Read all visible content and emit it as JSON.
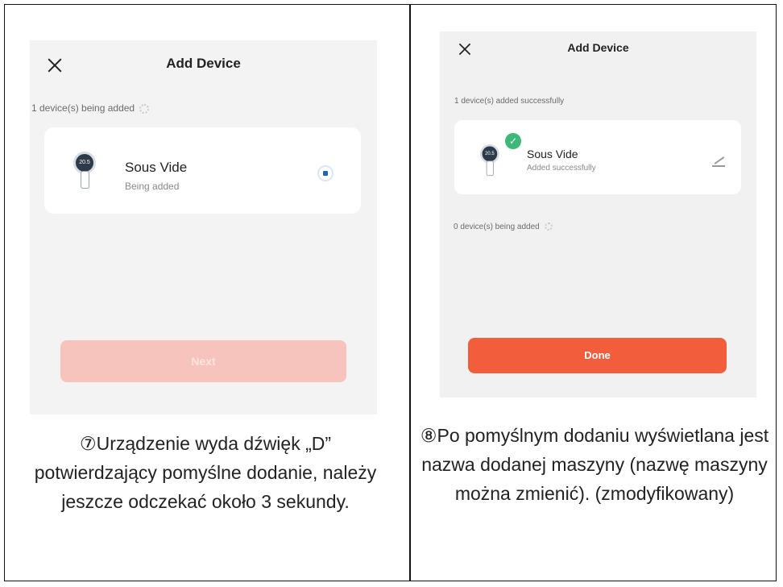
{
  "left_panel": {
    "header_title": "Add Device",
    "status_text": "1 device(s) being added",
    "device": {
      "name": "Sous Vide",
      "status": "Being added",
      "dial_value": "20.5"
    },
    "next_button_label": "Next",
    "caption": "⑦Urządzenie wyda dźwięk „D” potwierdzający pomyślne dodanie, należy jeszcze odczekać około 3 sekundy."
  },
  "right_panel": {
    "header_title": "Add Device",
    "success_text": "1 device(s) added successfully",
    "device": {
      "name": "Sous Vide",
      "status": "Added successfully",
      "dial_value": "20.5"
    },
    "pending_text": "0 device(s) being added",
    "done_button_label": "Done",
    "caption": "⑧Po pomyślnym dodaniu wyświetlana jest nazwa dodanej maszyny (nazwę maszyny można zmienić). (zmodyfikowany)"
  },
  "colors": {
    "accent_orange": "#f25e3c",
    "accent_orange_disabled": "#f7c4bd",
    "success_green": "#3cb879",
    "radio_blue": "#1f64b8"
  },
  "icons": [
    "close-icon",
    "spinner-icon",
    "device-thumbnail",
    "radio-selected-icon",
    "check-badge-icon",
    "edit-pencil-icon"
  ]
}
